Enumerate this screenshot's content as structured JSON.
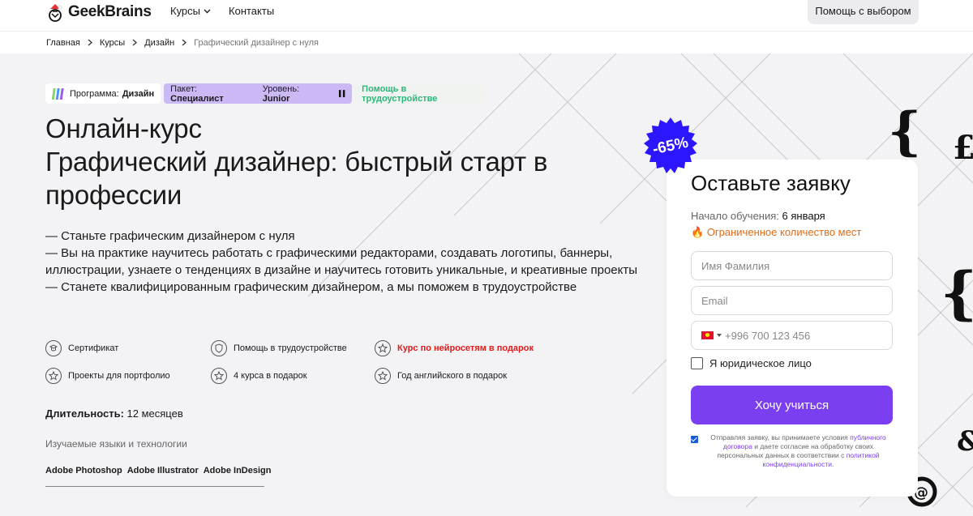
{
  "header": {
    "logo_text": "GeekBrains",
    "nav": [
      {
        "label": "Курсы",
        "has_dropdown": true
      },
      {
        "label": "Контакты",
        "has_dropdown": false
      }
    ],
    "help_button": "Помощь с выбором"
  },
  "breadcrumbs": [
    "Главная",
    "Курсы",
    "Дизайн",
    "Графический дизайнер с нуля"
  ],
  "tags": {
    "program_label": "Программа:",
    "program_value": "Дизайн",
    "pack_label": "Пакет:",
    "pack_value": "Специалист",
    "level_label": "Уровень:",
    "level_value": "Junior",
    "help": "Помощь в трудоустройстве"
  },
  "title_lines": [
    "Онлайн-курс",
    "Графический дизайнер: быстрый старт в",
    "профессии"
  ],
  "description_lines": [
    "— Станьте графическим дизайнером с нуля",
    "— Вы на практике научитесь работать с графическими редакторами, создавать логотипы, баннеры,",
    "иллюстрации, узнаете о тенденциях в дизайне и научитесь готовить уникальные, и креативные проекты",
    "— Станете квалифицированным графическим дизайнером, а мы поможем в трудоустройстве"
  ],
  "features": [
    {
      "label": "Сертификат",
      "icon": "certificate-icon",
      "highlight": false
    },
    {
      "label": "Помощь в трудоустройстве",
      "icon": "shield-icon",
      "highlight": false
    },
    {
      "label": "Курс по нейросетям в подарок",
      "icon": "star-icon",
      "highlight": true
    },
    {
      "label": "Проекты для портфолио",
      "icon": "star-icon",
      "highlight": false
    },
    {
      "label": "4 курса в подарок",
      "icon": "star-icon",
      "highlight": false
    },
    {
      "label": "Год английского в подарок",
      "icon": "star-icon",
      "highlight": false
    }
  ],
  "duration": {
    "label": "Длительность:",
    "value": "12 месяцев"
  },
  "tech": {
    "title": "Изучаемые языки и технологии",
    "items": [
      "Adobe Photoshop",
      "Adobe Illustrator",
      "Adobe InDesign"
    ]
  },
  "badge": "-65%",
  "form": {
    "title": "Оставьте заявку",
    "start_label": "Начало обучения:",
    "start_value": "6 января",
    "limited": "Ограниченное количество мест",
    "name_placeholder": "Имя Фамилия",
    "email_placeholder": "Email",
    "phone_placeholder": "+996 700 123 456",
    "legal_label": "Я юридическое лицо",
    "submit": "Хочу учиться",
    "consent_1": "Отправляя заявку, вы принимаете условия",
    "consent_link_1": "публичного договора",
    "consent_2": " и даете согласие на обработку своих персональных данных в соответствии с ",
    "consent_link_2": "политикой конфиденциальности",
    "consent_3": "."
  },
  "colors": {
    "accent": "#7b3ff2",
    "badge": "#2b16ff",
    "pack_tag": "#cbb9f5",
    "help_tag_text": "#2bb87a",
    "limited": "#e36b14",
    "highlight_feature": "#e01d1d"
  }
}
